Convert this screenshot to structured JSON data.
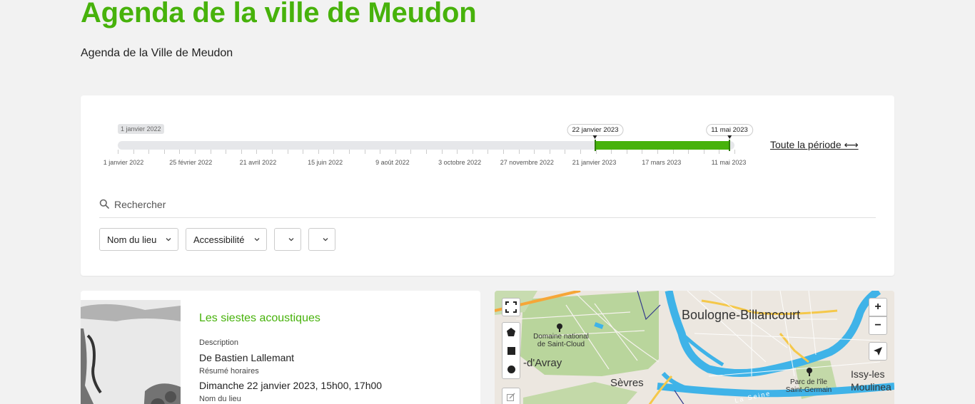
{
  "header": {
    "title": "Agenda de la ville de Meudon",
    "subtitle": "Agenda de la Ville de Meudon"
  },
  "timeline": {
    "min_label": "1 janvier 2022",
    "start_flag": "22 janvier 2023",
    "end_flag": "11 mai 2023",
    "tick_labels": [
      "1 janvier 2022",
      "25 février 2022",
      "21 avril 2022",
      "15 juin 2022",
      "9 août 2022",
      "3 octobre 2022",
      "27 novembre 2022",
      "21 janvier 2023",
      "17 mars 2023",
      "11 mai 2023"
    ],
    "all_period_label": "Toute la période ⟷",
    "accent_color": "#47b20b"
  },
  "search": {
    "placeholder": "Rechercher"
  },
  "filters": [
    {
      "label": "Nom du lieu"
    },
    {
      "label": "Accessibilité"
    },
    {
      "label": ""
    },
    {
      "label": ""
    }
  ],
  "event": {
    "title": "Les siestes acoustiques",
    "description_label": "Description",
    "description_value": "De Bastien Lallemant",
    "schedule_label": "Résumé horaires",
    "schedule_value": "Dimanche 22 janvier 2023, 15h00, 17h00",
    "venue_label": "Nom du lieu"
  },
  "map": {
    "labels": {
      "boulogne": "Boulogne-Billancourt",
      "domaine": "Domaine national de Saint-Cloud",
      "davray": "-d'Avray",
      "sevres": "Sèvres",
      "parc": "Parc de l'île Saint-Germain",
      "issy": "Issy-les Moulinea",
      "seine": "La Seine"
    },
    "zoom_in": "+",
    "zoom_out": "−"
  }
}
